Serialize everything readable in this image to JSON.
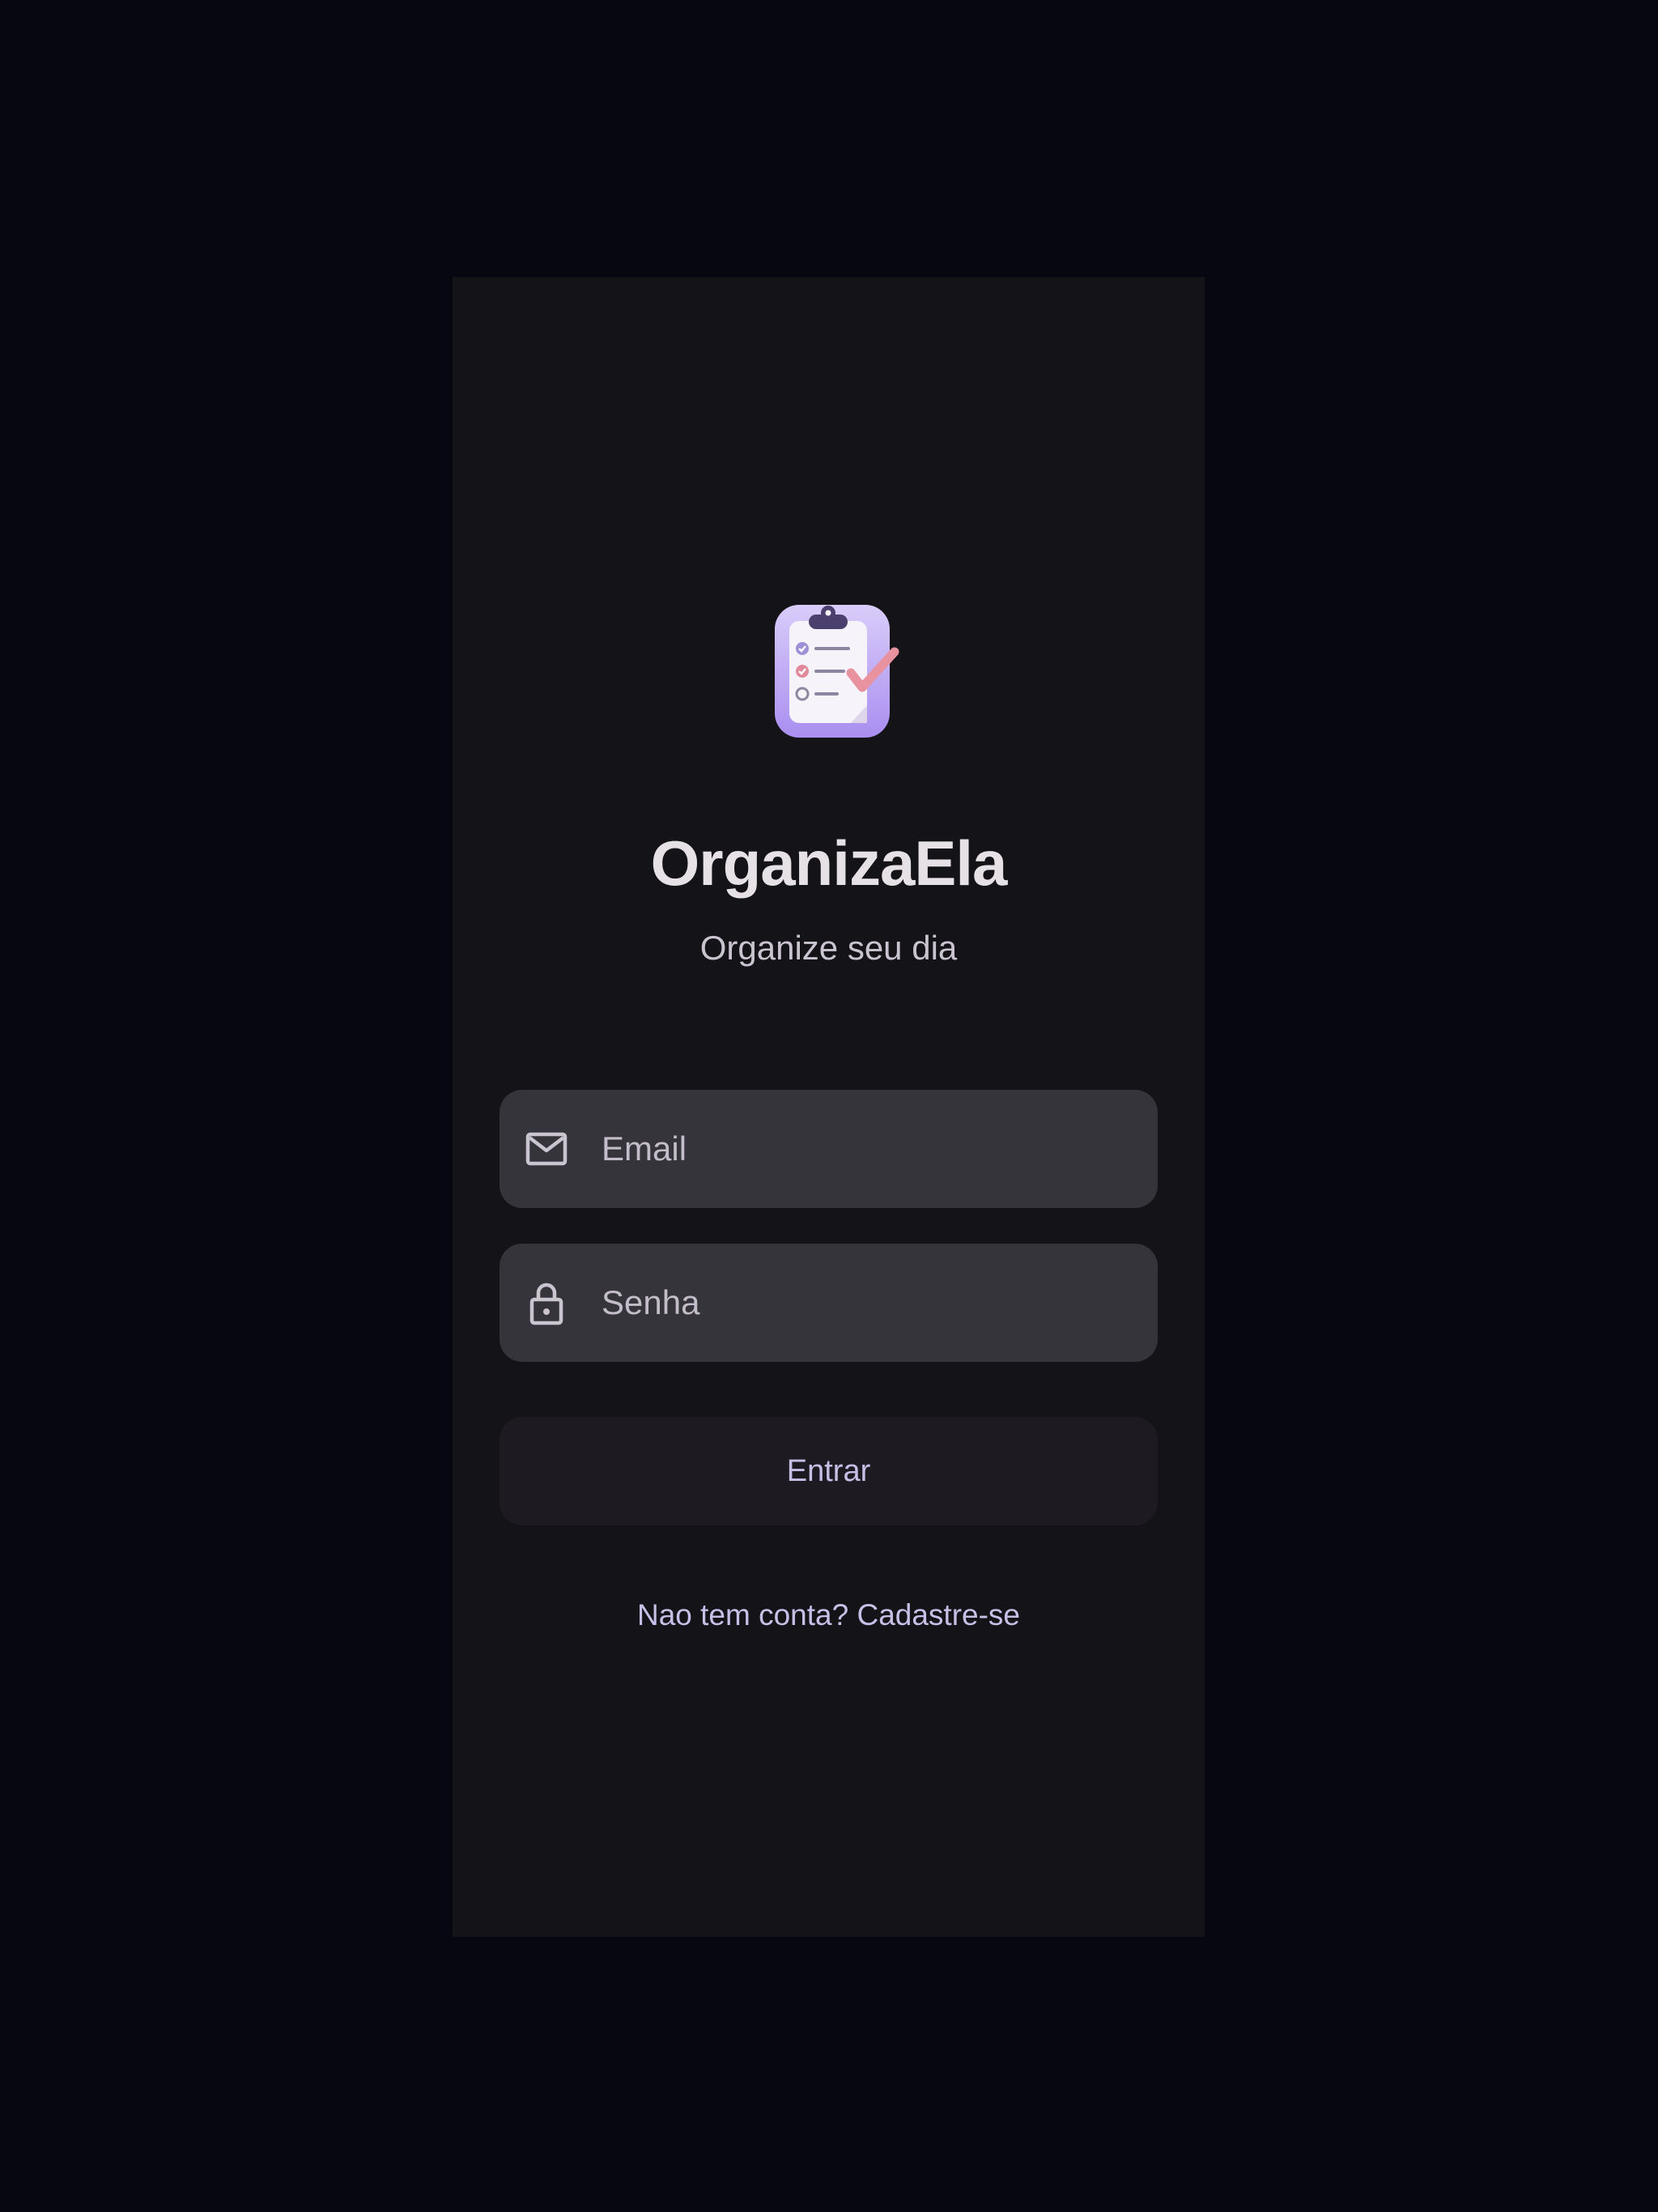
{
  "app": {
    "title": "OrganizaEla",
    "subtitle": "Organize seu dia",
    "logo_icon": "clipboard-checklist-icon"
  },
  "form": {
    "email": {
      "placeholder": "Email",
      "value": "",
      "icon": "mail-icon"
    },
    "password": {
      "placeholder": "Senha",
      "value": "",
      "icon": "lock-icon"
    },
    "submit_label": "Entrar",
    "signup_link": "Nao tem conta? Cadastre-se"
  },
  "colors": {
    "background": "#070711",
    "surface": "#141318",
    "field": "#36343b",
    "button": "#1d1b21",
    "accent": "#c8bfe7",
    "logo_purple": "#b9a5f4",
    "logo_pink": "#e8919f"
  }
}
